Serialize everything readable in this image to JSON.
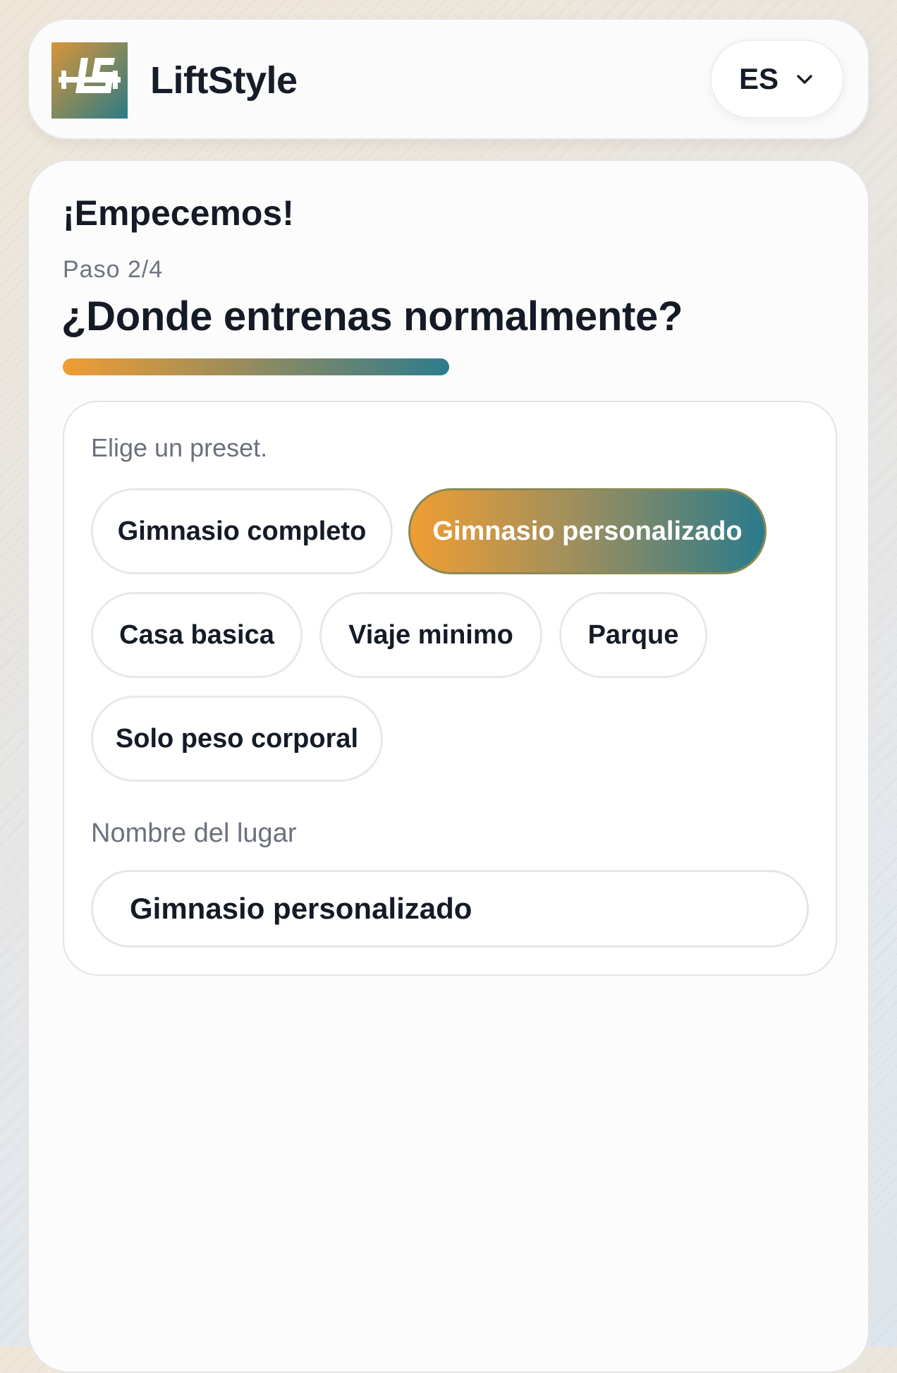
{
  "header": {
    "brand": "LiftStyle",
    "language": {
      "code": "ES"
    }
  },
  "onboarding": {
    "greeting": "¡Empecemos!",
    "step": "Paso 2/4",
    "question": "¿Donde entrenas normalmente?",
    "progress_fraction": 0.5,
    "colors": {
      "accent_start": "#f09d33",
      "accent_end": "#2a7b8c"
    }
  },
  "preset_panel": {
    "hint": "Elige un preset.",
    "presets": [
      {
        "label": "Gimnasio completo",
        "selected": false
      },
      {
        "label": "Gimnasio personalizado",
        "selected": true
      },
      {
        "label": "Casa basica",
        "selected": false
      },
      {
        "label": "Viaje minimo",
        "selected": false
      },
      {
        "label": "Parque",
        "selected": false
      },
      {
        "label": "Solo peso corporal",
        "selected": false
      }
    ],
    "place_name_label": "Nombre del lugar",
    "place_name_value": "Gimnasio personalizado"
  }
}
